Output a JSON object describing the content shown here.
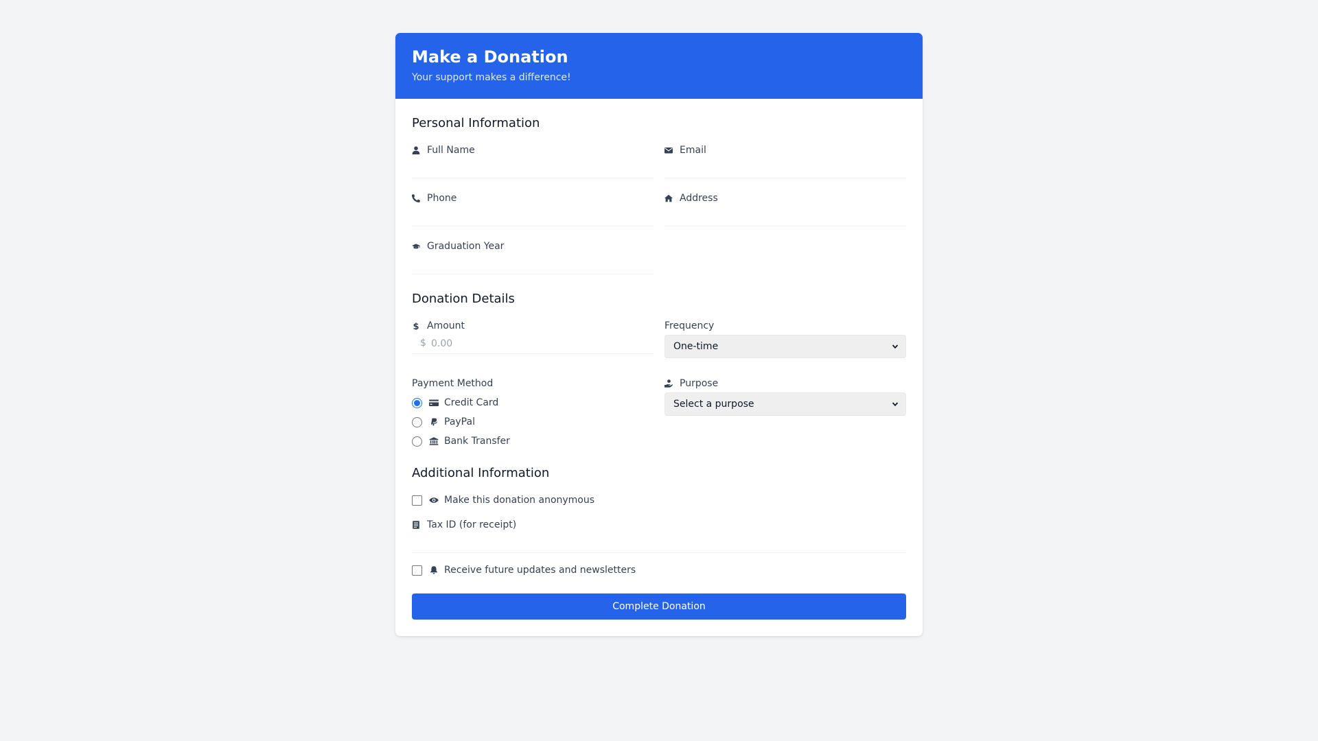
{
  "header": {
    "title": "Make a Donation",
    "subtitle": "Your support makes a difference!"
  },
  "personal": {
    "section_title": "Personal Information",
    "full_name": {
      "label": "Full Name",
      "value": "",
      "icon": "user-icon"
    },
    "email": {
      "label": "Email",
      "value": "",
      "icon": "envelope-icon"
    },
    "phone": {
      "label": "Phone",
      "value": "",
      "icon": "phone-icon"
    },
    "address": {
      "label": "Address",
      "value": "",
      "icon": "home-icon"
    },
    "graduation_year": {
      "label": "Graduation Year",
      "value": "",
      "icon": "graduation-cap-icon"
    }
  },
  "donation": {
    "section_title": "Donation Details",
    "amount": {
      "label": "Amount",
      "currency_symbol": "$",
      "placeholder": "0.00",
      "value": "",
      "icon": "dollar-icon"
    },
    "frequency": {
      "label": "Frequency",
      "selected": "One-time"
    },
    "payment": {
      "label": "Payment Method",
      "options": [
        {
          "label": "Credit Card",
          "checked": true,
          "icon": "credit-card-icon"
        },
        {
          "label": "PayPal",
          "checked": false,
          "icon": "paypal-icon"
        },
        {
          "label": "Bank Transfer",
          "checked": false,
          "icon": "bank-icon"
        }
      ]
    },
    "purpose": {
      "label": "Purpose",
      "selected": "Select a purpose",
      "icon": "hand-holding-icon"
    }
  },
  "additional": {
    "section_title": "Additional Information",
    "anonymous": {
      "label": "Make this donation anonymous",
      "checked": false,
      "icon": "eye-icon"
    },
    "tax_id": {
      "label": "Tax ID (for receipt)",
      "value": "",
      "icon": "receipt-icon"
    },
    "newsletter": {
      "label": "Receive future updates and newsletters",
      "checked": false,
      "icon": "bell-icon"
    }
  },
  "submit_label": "Complete Donation",
  "colors": {
    "primary": "#2563eb",
    "page_bg": "#f3f4f6",
    "radio_accent": "#1a73e8"
  }
}
